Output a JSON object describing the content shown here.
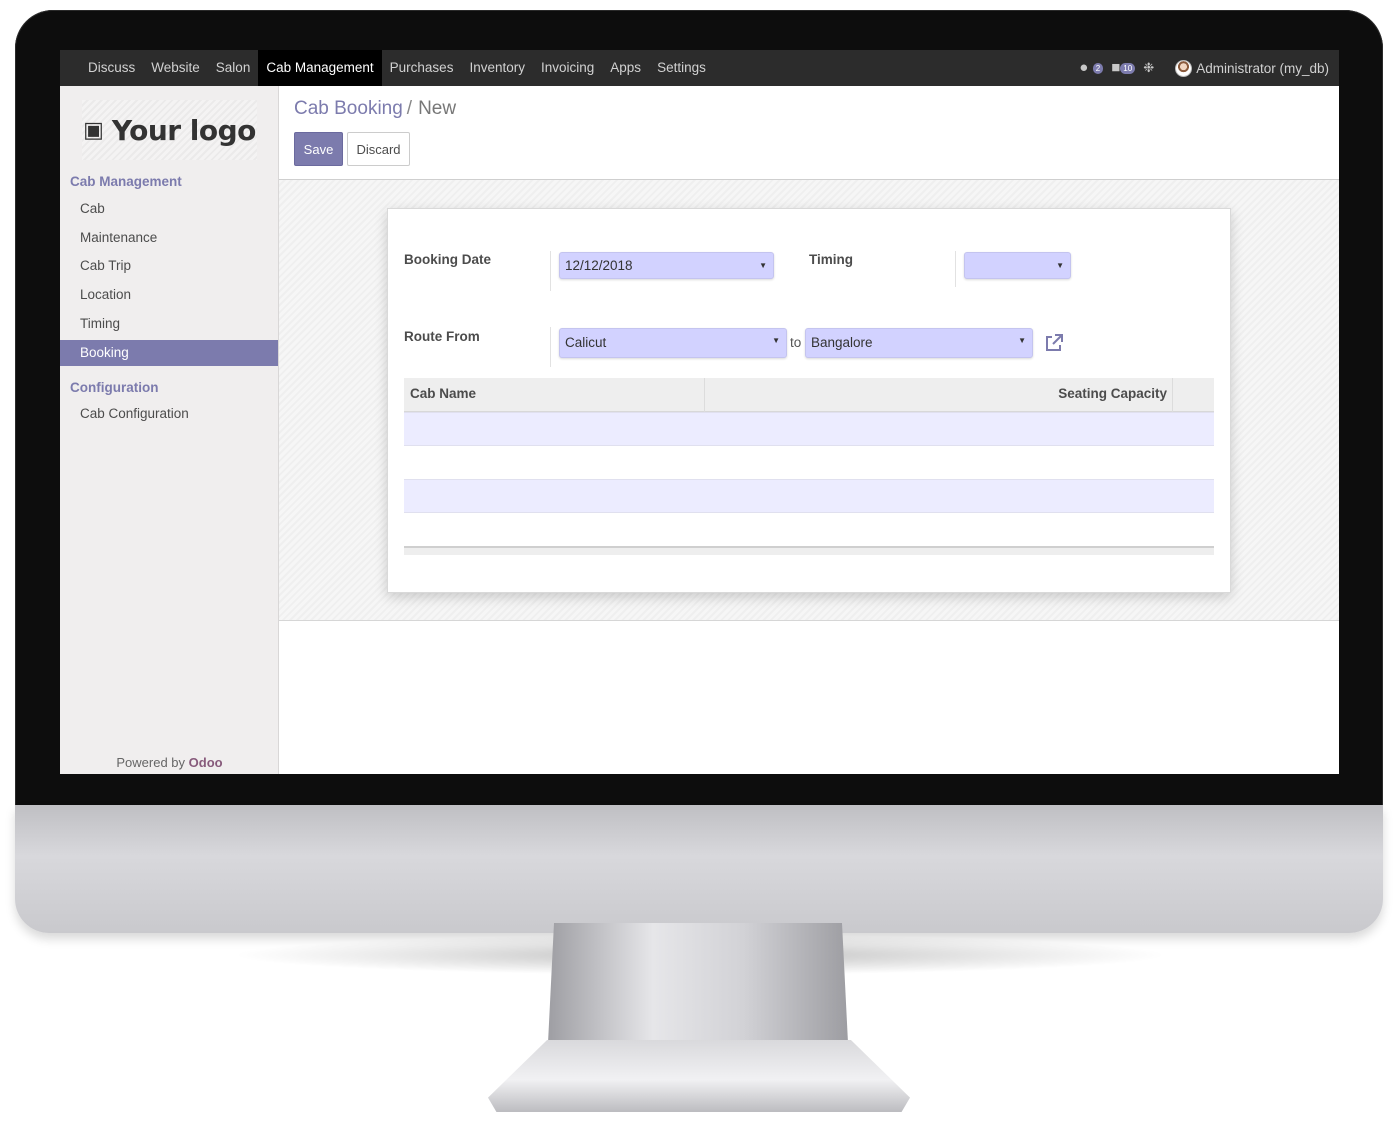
{
  "topbar": {
    "menu": [
      "Discuss",
      "Website",
      "Salon",
      "Cab Management",
      "Purchases",
      "Inventory",
      "Invoicing",
      "Apps",
      "Settings"
    ],
    "active_menu": "Cab Management",
    "chat_badge": "2",
    "messages_badge": "10",
    "user_label": "Administrator (my_db)"
  },
  "sidebar": {
    "logo_text": "Your logo",
    "section1": "Cab Management",
    "items": [
      "Cab",
      "Maintenance",
      "Cab Trip",
      "Location",
      "Timing",
      "Booking"
    ],
    "active_item": "Booking",
    "section2": "Configuration",
    "config_items": [
      "Cab Configuration"
    ],
    "powered_prefix": "Powered by",
    "powered_brand": "Odoo"
  },
  "control_panel": {
    "breadcrumb_parent": "Cab Booking",
    "breadcrumb_sep": "/",
    "breadcrumb_current": "New",
    "save_label": "Save",
    "discard_label": "Discard"
  },
  "form": {
    "booking_date_label": "Booking Date",
    "booking_date_value": "12/12/2018",
    "timing_label": "Timing",
    "timing_value": "",
    "route_from_label": "Route From",
    "route_from_value": "Calicut",
    "route_to_text": "to",
    "route_to_value": "Bangalore"
  },
  "table": {
    "columns": [
      "Cab Name",
      "Seating Capacity"
    ],
    "rows": []
  },
  "colors": {
    "accent": "#7c7bad",
    "field_bg": "#d2d2ff",
    "topbar": "#2c2c2c"
  }
}
